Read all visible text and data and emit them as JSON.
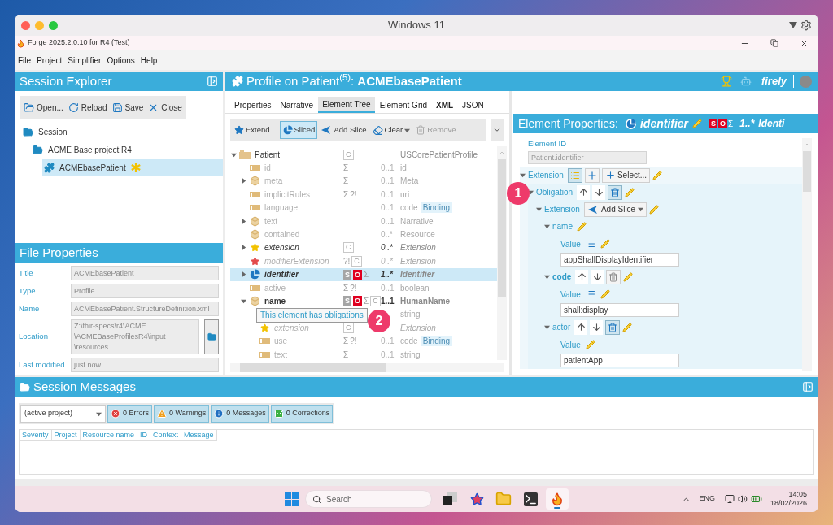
{
  "mac_window": {
    "title": "Windows 11"
  },
  "app_window": {
    "title": "Forge 2025.2.0.10 for R4 (Test)"
  },
  "menu": [
    "File",
    "Project",
    "Simplifier",
    "Options",
    "Help"
  ],
  "session_explorer": {
    "title": "Session Explorer",
    "toolbar": [
      {
        "kind": "open",
        "label": "Open..."
      },
      {
        "kind": "reload",
        "label": "Reload"
      },
      {
        "kind": "save",
        "label": "Save"
      },
      {
        "kind": "close",
        "label": "Close"
      }
    ],
    "tree": [
      {
        "kind": "folder",
        "label": "Session",
        "selected": false,
        "modified": false,
        "children": [
          {
            "kind": "folder",
            "label": "ACME Base project R4",
            "selected": false,
            "modified": false,
            "children": [
              {
                "kind": "profile",
                "label": "ACMEbasePatient",
                "selected": true,
                "modified": true
              }
            ]
          }
        ]
      }
    ]
  },
  "file_properties": {
    "title": "File Properties",
    "fields": [
      {
        "kind": "text",
        "label": "Title",
        "value": "ACMEbasePatient"
      },
      {
        "kind": "text",
        "label": "Type",
        "value": "Profile"
      },
      {
        "kind": "text",
        "label": "Name",
        "value": "ACMEbasePatient.StructureDefinition.xml"
      },
      {
        "kind": "path",
        "label": "Location",
        "value": "Z:\\fhir-specs\\r4\\ACME\n\\ACMEBaseProfilesR4\\input\n\\resources"
      },
      {
        "kind": "text",
        "label": "Last modified",
        "value": "just now"
      }
    ]
  },
  "profile_header": {
    "title": "Profile on Patient$^{(5)}$: **ACMEbasePatient**",
    "brand": "firely"
  },
  "tabs": [
    {
      "label": "Properties",
      "selected": false,
      "bold": false
    },
    {
      "label": "Narrative",
      "selected": false,
      "bold": false
    },
    {
      "label": "Element Tree",
      "selected": true,
      "bold": false
    },
    {
      "label": "Element Grid",
      "selected": false,
      "bold": false
    },
    {
      "label": "XML",
      "selected": false,
      "bold": true
    },
    {
      "label": "JSON",
      "selected": false,
      "bold": false
    }
  ],
  "tree_toolbar": [
    {
      "kind": "extend",
      "label": "Extend...",
      "pressed": false,
      "disabled": false
    },
    {
      "kind": "sliced",
      "label": "Sliced",
      "pressed": true,
      "disabled": false
    },
    {
      "kind": "add-slice",
      "label": "Add Slice",
      "pressed": false,
      "disabled": false
    },
    {
      "kind": "clear",
      "label": "Clear",
      "pressed": false,
      "disabled": false
    },
    {
      "kind": "remove",
      "label": "Remove",
      "pressed": false,
      "disabled": true
    }
  ],
  "element_tree": [
    {
      "name": "Patient",
      "kind": "resource",
      "expanded": true,
      "flags": [
        {
          "text": "C",
          "kind": "constraint"
        }
      ],
      "type": "USCorePatientProfile",
      "dimmed": false,
      "italic": false,
      "bold": false,
      "selected": false,
      "children": [
        {
          "name": "id",
          "kind": "field",
          "flags": [
            {
              "text": "Σ",
              "kind": "summary"
            }
          ],
          "cardinality": "0..1",
          "type": "id",
          "dimmed": true,
          "italic": false,
          "bold": false,
          "selected": false
        },
        {
          "name": "meta",
          "kind": "cube",
          "expanded": false,
          "flags": [
            {
              "text": "Σ",
              "kind": "summary"
            }
          ],
          "cardinality": "0..1",
          "type": "Meta",
          "dimmed": true,
          "italic": false,
          "bold": false,
          "selected": false
        },
        {
          "name": "implicitRules",
          "kind": "field",
          "flags": [
            {
              "text": "Σ",
              "kind": "summary"
            },
            {
              "text": "?!",
              "kind": "modifier"
            }
          ],
          "cardinality": "0..1",
          "type": "uri",
          "dimmed": true,
          "italic": false,
          "bold": false,
          "selected": false
        },
        {
          "name": "language",
          "kind": "field",
          "cardinality": "0..1",
          "type": "code",
          "binding": "Binding",
          "dimmed": true,
          "italic": false,
          "bold": false,
          "selected": false
        },
        {
          "name": "text",
          "kind": "cube",
          "expanded": false,
          "cardinality": "0..1",
          "type": "Narrative",
          "dimmed": true,
          "italic": false,
          "bold": false,
          "selected": false
        },
        {
          "name": "contained",
          "kind": "cube",
          "cardinality": "0..*",
          "type": "Resource",
          "dimmed": true,
          "italic": false,
          "bold": false,
          "selected": false
        },
        {
          "name": "extension",
          "kind": "star",
          "expanded": false,
          "flags": [
            {
              "text": "C",
              "kind": "constraint"
            }
          ],
          "cardinality": "0..*",
          "type": "Extension",
          "dimmed": false,
          "italic": true,
          "bold": false,
          "selected": false
        },
        {
          "name": "modifierExtension",
          "kind": "modifier-star",
          "flags": [
            {
              "text": "?!",
              "kind": "modifier"
            },
            {
              "text": "C",
              "kind": "constraint"
            }
          ],
          "cardinality": "0..*",
          "type": "Extension",
          "dimmed": true,
          "italic": true,
          "bold": false,
          "selected": false
        },
        {
          "name": "identifier",
          "kind": "slice",
          "expanded": false,
          "flags": [
            {
              "text": "S",
              "kind": "must-support"
            },
            {
              "text": "O",
              "kind": "obligation"
            },
            {
              "text": "Σ",
              "kind": "summary"
            }
          ],
          "cardinality": "1..*",
          "type": "Identifier",
          "dimmed": false,
          "italic": true,
          "bold": true,
          "selected": true
        },
        {
          "name": "active",
          "kind": "field",
          "flags": [
            {
              "text": "Σ",
              "kind": "summary"
            },
            {
              "text": "?!",
              "kind": "modifier"
            }
          ],
          "cardinality": "0..1",
          "type": "boolean",
          "dimmed": true,
          "italic": false,
          "bold": false,
          "selected": false
        },
        {
          "name": "name",
          "kind": "cube",
          "expanded": true,
          "flags": [
            {
              "text": "S",
              "kind": "must-support"
            },
            {
              "text": "O",
              "kind": "obligation"
            },
            {
              "text": "Σ",
              "kind": "summary"
            },
            {
              "text": "C",
              "kind": "constraint"
            }
          ],
          "cardinality": "1..1",
          "type": "HumanName",
          "dimmed": false,
          "italic": false,
          "bold": true,
          "selected": false,
          "children": [
            {
              "type": "string",
              "dimmed": true,
              "italic": false,
              "bold": false,
              "selected": false
            },
            {
              "name": "extension",
              "kind": "star",
              "flags": [
                {
                  "text": "C",
                  "kind": "constraint"
                }
              ],
              "type": "Extension",
              "dimmed": true,
              "italic": true,
              "bold": false,
              "selected": false
            },
            {
              "name": "use",
              "kind": "field",
              "flags": [
                {
                  "text": "Σ",
                  "kind": "summary"
                },
                {
                  "text": "?!",
                  "kind": "modifier"
                }
              ],
              "cardinality": "0..1",
              "type": "code",
              "binding": "Binding",
              "dimmed": true,
              "italic": false,
              "bold": false,
              "selected": false
            },
            {
              "name": "text",
              "kind": "field",
              "flags": [
                {
                  "text": "Σ",
                  "kind": "summary"
                }
              ],
              "cardinality": "0..1",
              "type": "string",
              "dimmed": true,
              "italic": false,
              "bold": false,
              "selected": false
            }
          ]
        }
      ]
    }
  ],
  "element_properties": {
    "title": "Element Properties:",
    "element": "identifier",
    "flags": [
      {
        "text": "S",
        "kind": "must-support"
      },
      {
        "text": "O",
        "kind": "obligation"
      },
      {
        "text": "Σ",
        "kind": "summary"
      }
    ],
    "cardinality": "1..*",
    "type": "Identi",
    "id_label": "Element ID",
    "id_value": "Patient.identifier",
    "tree": [
      {
        "label": "Extension",
        "bold": false,
        "buttons": [
          {
            "kind": "list",
            "pressed": true
          },
          {
            "kind": "add",
            "pressed": false
          },
          {
            "kind": "select",
            "label": "Select...",
            "pressed": false
          }
        ],
        "children": [
          {
            "label": "Obligation",
            "bold": false,
            "buttons": [
              {
                "kind": "up"
              },
              {
                "kind": "down"
              },
              {
                "kind": "delete",
                "pressed": true
              }
            ],
            "children": [
              {
                "label": "Extension",
                "bold": false,
                "buttons": [
                  {
                    "kind": "add-slice",
                    "label": "Add Slice",
                    "pressed": false
                  }
                ],
                "children": [
                  {
                    "label": "name",
                    "bold": false,
                    "children": [
                      {
                        "kind": "value",
                        "label": "Value",
                        "list": true,
                        "value": "appShallDisplayIdentifier"
                      }
                    ]
                  },
                  {
                    "label": "code",
                    "bold": true,
                    "buttons": [
                      {
                        "kind": "up"
                      },
                      {
                        "kind": "down"
                      },
                      {
                        "kind": "delete",
                        "pressed": false
                      }
                    ],
                    "children": [
                      {
                        "kind": "value",
                        "label": "Value",
                        "list": true,
                        "value": "shall:display"
                      }
                    ]
                  },
                  {
                    "label": "actor",
                    "bold": false,
                    "buttons": [
                      {
                        "kind": "up"
                      },
                      {
                        "kind": "down"
                      },
                      {
                        "kind": "delete",
                        "pressed": true
                      }
                    ],
                    "children": [
                      {
                        "kind": "value",
                        "label": "Value",
                        "list": false,
                        "value": "patientApp"
                      }
                    ]
                  }
                ]
              }
            ]
          }
        ]
      }
    ]
  },
  "session_messages": {
    "title": "Session Messages",
    "scope": "(active project)",
    "filters": [
      {
        "kind": "error",
        "label": "0 Errors"
      },
      {
        "kind": "warning",
        "label": "0 Warnings"
      },
      {
        "kind": "info",
        "label": "0 Messages"
      },
      {
        "kind": "correction",
        "label": "0 Corrections"
      }
    ],
    "columns": [
      "Severity",
      "Project",
      "Resource name",
      "ID",
      "Context",
      "Message"
    ]
  },
  "tooltip": "This element has obligations",
  "callouts": [
    "1",
    "2"
  ],
  "taskbar": {
    "search_placeholder": "Search",
    "apps": [
      {
        "kind": "task-view",
        "active": false
      },
      {
        "kind": "star-app",
        "active": false
      },
      {
        "kind": "folder",
        "active": false
      },
      {
        "kind": "terminal",
        "active": false
      },
      {
        "kind": "flame",
        "active": true
      }
    ],
    "language": "ENG",
    "time": "14:05",
    "date": "18/02/2026"
  }
}
